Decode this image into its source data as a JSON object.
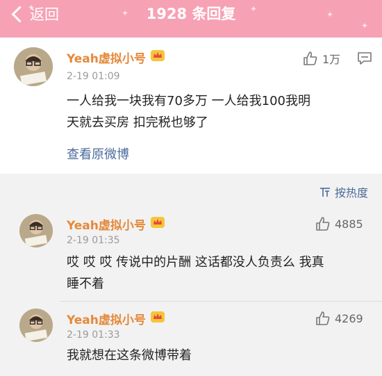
{
  "header": {
    "back_label": "返回",
    "title": "1928 条回复"
  },
  "main_post": {
    "username": "Yeah虚拟小号",
    "time": "2-19 01:09",
    "content_line1": "一人给我一块我有70多万 一人给我100我明",
    "content_line2": "天就去买房 扣完税也够了",
    "like_count": "1万",
    "view_original": "查看原微博"
  },
  "sort": {
    "label": "按热度"
  },
  "replies": [
    {
      "username": "Yeah虚拟小号",
      "time": "2-19 01:35",
      "content_line1": "哎 哎 哎 传说中的片酬 这话都没人负责么 我真",
      "content_line2": "睡不着",
      "like_count": "4885"
    },
    {
      "username": "Yeah虚拟小号",
      "time": "2-19 01:33",
      "content_line1": "我就想在这条微博带着",
      "content_line2": "",
      "like_count": "4269"
    }
  ],
  "icons": {
    "back": "chevron-left-icon",
    "crown": "crown-icon",
    "like": "thumbs-up-icon",
    "comment": "comment-icon",
    "sort": "sort-icon"
  },
  "colors": {
    "header_bg": "#f7a1b4",
    "username": "#e5893a",
    "link": "#4a6a9a"
  }
}
